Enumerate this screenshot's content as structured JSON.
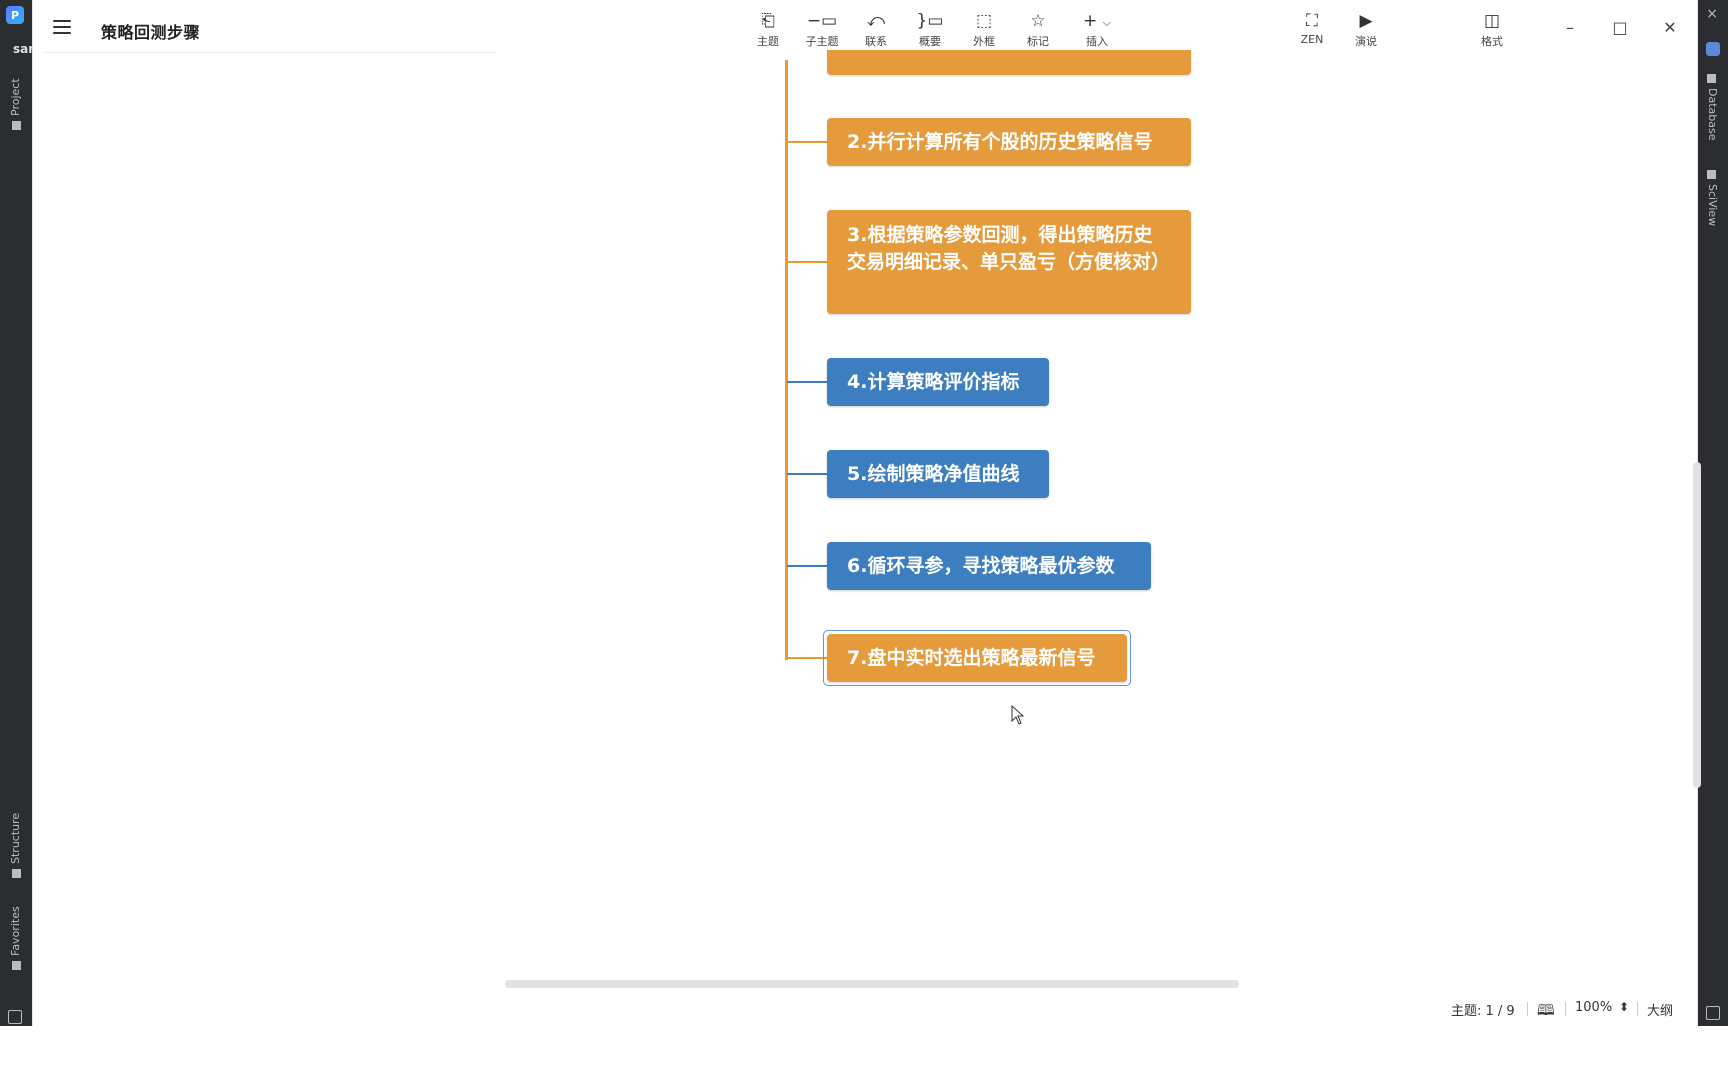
{
  "ide": {
    "project_short": "sar",
    "left_tabs": {
      "project": "Project",
      "structure": "Structure",
      "favorites": "Favorites"
    },
    "right_tabs": {
      "database": "Database",
      "sciview": "SciView"
    }
  },
  "app": {
    "document_title": "策略回测步骤"
  },
  "toolbar": {
    "topic": {
      "label": "主题",
      "icon": "topic-icon"
    },
    "subtopic": {
      "label": "子主题",
      "icon": "subtopic-icon"
    },
    "relationship": {
      "label": "联系",
      "icon": "relationship-icon"
    },
    "summary": {
      "label": "概要",
      "icon": "summary-icon"
    },
    "boundary": {
      "label": "外框",
      "icon": "boundary-icon"
    },
    "marker": {
      "label": "标记",
      "icon": "star-icon"
    },
    "insert": {
      "label": "插入",
      "icon": "plus-icon"
    },
    "zen": {
      "label": "ZEN",
      "icon": "fullscreen-icon"
    },
    "pitch": {
      "label": "演说",
      "icon": "present-icon"
    },
    "format": {
      "label": "格式",
      "icon": "format-panel-icon"
    }
  },
  "mindmap": {
    "branch_color": "#e89a2f",
    "topics": [
      {
        "text": "2.并行计算所有个股的历史策略信号",
        "color": "orange"
      },
      {
        "text": "3.根据策略参数回测，得出策略历史交易明细记录、单只盈亏（方便核对）",
        "color": "orange"
      },
      {
        "text": "4.计算策略评价指标",
        "color": "blue"
      },
      {
        "text": "5.绘制策略净值曲线",
        "color": "blue"
      },
      {
        "text": "6.循环寻参，寻找策略最优参数",
        "color": "blue"
      },
      {
        "text": "7.盘中实时选出策略最新信号",
        "color": "orange",
        "selected": true
      }
    ],
    "colors": {
      "orange": "#e59b3c",
      "blue": "#3c7ebf",
      "selection": "#5b95e6"
    }
  },
  "statusbar": {
    "topic_count": "主题: 1 / 9",
    "zoom": "100%",
    "outline": "大纲"
  }
}
